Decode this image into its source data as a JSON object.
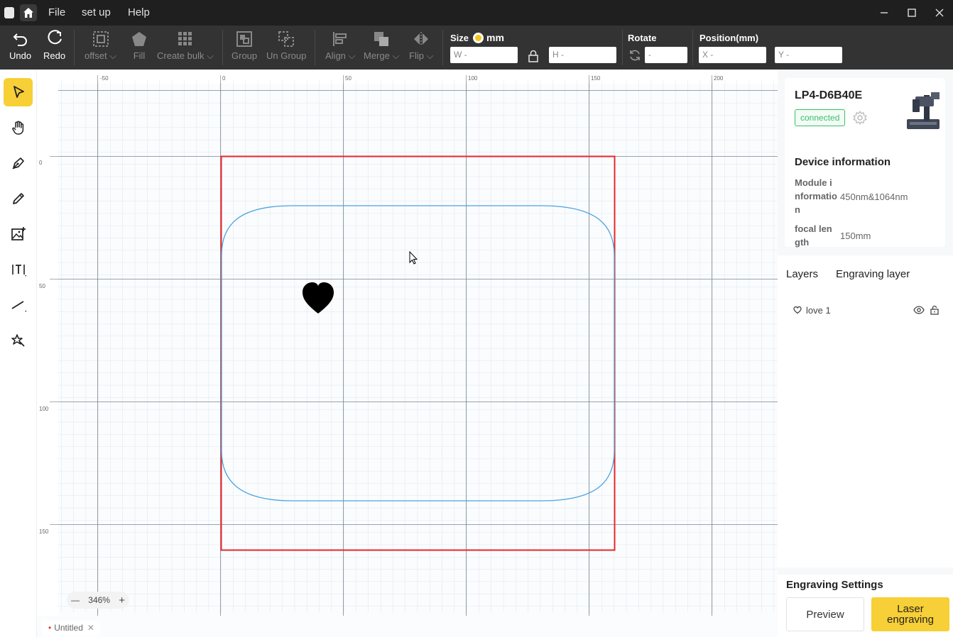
{
  "titlebar": {
    "menus": [
      "File",
      "set up",
      "Help"
    ]
  },
  "toolbar": {
    "undo": "Undo",
    "redo": "Redo",
    "offset": "offset",
    "fill": "Fill",
    "create_bulk": "Create bulk",
    "group": "Group",
    "ungroup": "Un Group",
    "align": "Align",
    "merge": "Merge",
    "flip": "Flip",
    "size_label": "Size",
    "size_unit": "mm",
    "w_placeholder": "W -",
    "h_placeholder": "H -",
    "rotate_label": "Rotate",
    "rotate_placeholder": "-",
    "position_label": "Position(mm)",
    "x_placeholder": "X -",
    "y_placeholder": "Y -"
  },
  "ruler": {
    "x_ticks": [
      "-50",
      "0",
      "50",
      "100",
      "150",
      "200"
    ],
    "y_ticks": [
      "0",
      "50",
      "100",
      "150"
    ]
  },
  "canvas": {
    "zoom": "346%",
    "work_area_color": "#e8262b",
    "path_color": "#4aa3e0"
  },
  "document_tab": {
    "name": "Untitled"
  },
  "device": {
    "name": "LP4-D6B40E",
    "status": "connected",
    "info_title": "Device information",
    "module_key": "Module information",
    "module_value": "450nm&1064nm",
    "focal_key": "focal length",
    "focal_value": "150mm"
  },
  "layers": {
    "tab_layers": "Layers",
    "tab_engraving": "Engraving layer",
    "items": [
      {
        "name": "love 1"
      }
    ]
  },
  "engraving": {
    "title": "Engraving Settings",
    "preview": "Preview",
    "laser": "Laser engraving"
  }
}
